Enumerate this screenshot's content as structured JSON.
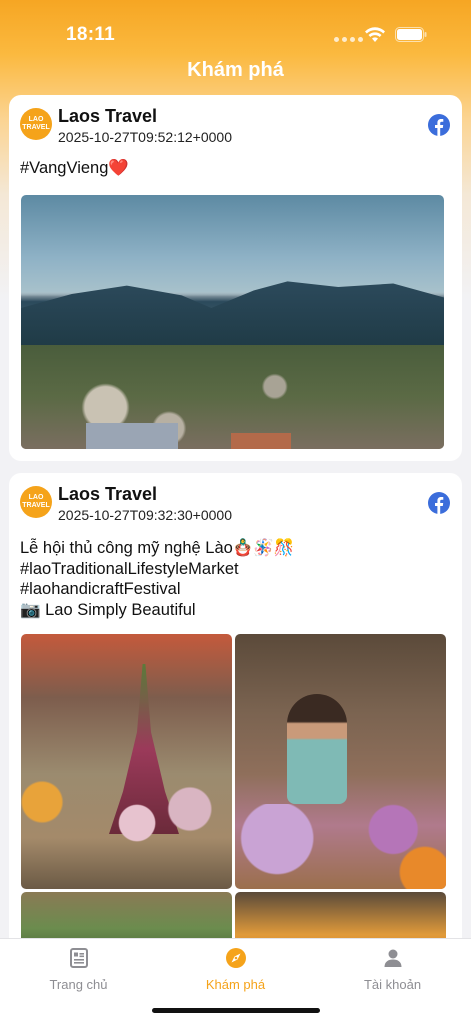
{
  "status_bar": {
    "time": "18:11"
  },
  "header": {
    "title": "Khám phá"
  },
  "posts": [
    {
      "author": "Laos Travel",
      "avatar_text_top": "LAO",
      "avatar_text_bottom": "TRAVEL",
      "timestamp": "2025-10-27T09:52:12+0000",
      "text": "#VangVieng❤️"
    },
    {
      "author": "Laos Travel",
      "avatar_text_top": "LAO",
      "avatar_text_bottom": "TRAVEL",
      "timestamp": "2025-10-27T09:32:30+0000",
      "text": "Lễ hội thủ công mỹ nghệ Lào🪆🪅🎊\n#laoTraditionalLifestyleMarket\n#laohandicraftFestival\n📷 Lao Simply Beautiful"
    }
  ],
  "tab_bar": {
    "items": [
      {
        "label": "Trang chủ",
        "icon": "newspaper-icon"
      },
      {
        "label": "Khám phá",
        "icon": "compass-icon",
        "active": true
      },
      {
        "label": "Tài khoản",
        "icon": "person-icon"
      }
    ]
  },
  "colors": {
    "accent": "#f5a31a",
    "facebook": "#3b6ddb",
    "inactive": "#8e8e93"
  }
}
